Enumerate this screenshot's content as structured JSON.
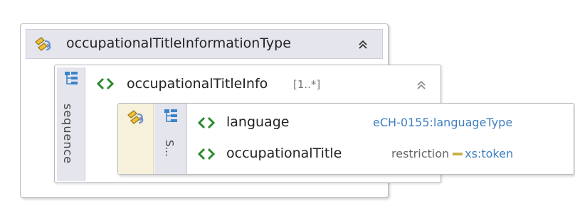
{
  "outer_type": {
    "name": "occupationalTitleInformationType",
    "icon": "complex-type-icon",
    "collapse_glyph": "≈"
  },
  "sequence": {
    "label": "sequence",
    "icon": "sequence-icon"
  },
  "element": {
    "name": "occupationalTitleInfo",
    "cardinality": "[1..*]",
    "icon": "element-icon",
    "collapse_glyph": "≈"
  },
  "inner_type": {
    "icon": "complex-type-icon",
    "sequence_label": "S...",
    "children": [
      {
        "name": "language",
        "type": "eCH-0155:languageType"
      },
      {
        "name": "occupationalTitle",
        "restriction": "restriction",
        "base": "xs:token"
      }
    ]
  },
  "colors": {
    "header_bg": "#e5e5ed",
    "element_icon": "#2c8b2f",
    "type_link": "#3f7fbf",
    "restriction_bar": "#c9b043",
    "cream": "#f7f1dc"
  }
}
